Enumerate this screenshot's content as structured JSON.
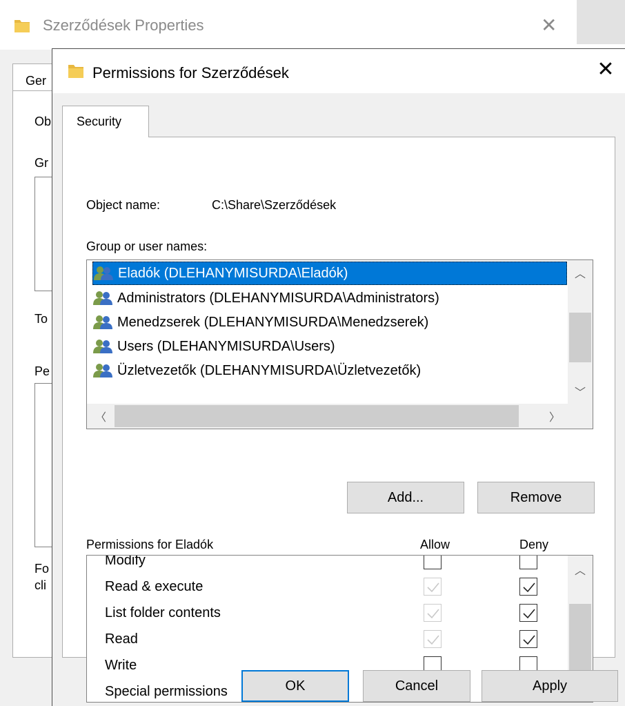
{
  "background_window": {
    "title": "Szerződések Properties",
    "tab_label": "Ger",
    "fragments": [
      "Ob",
      "Gr",
      "To",
      "Pe",
      "Fo",
      "cli"
    ]
  },
  "dialog": {
    "title": "Permissions for Szerződések",
    "tab": "Security",
    "object_name_label": "Object name:",
    "object_name_value": "C:\\Share\\Szerződések",
    "group_label": "Group or user names:",
    "users": [
      {
        "label": "Eladók (DLEHANYMISURDA\\Eladók)",
        "selected": true
      },
      {
        "label": "Administrators (DLEHANYMISURDA\\Administrators)",
        "selected": false
      },
      {
        "label": "Menedzserek (DLEHANYMISURDA\\Menedzserek)",
        "selected": false
      },
      {
        "label": "Users (DLEHANYMISURDA\\Users)",
        "selected": false
      },
      {
        "label": "Üzletvezetők (DLEHANYMISURDA\\Üzletvezetők)",
        "selected": false
      }
    ],
    "add_button": "Add...",
    "remove_button": "Remove",
    "permissions_title": "Permissions for Eladók",
    "allow_header": "Allow",
    "deny_header": "Deny",
    "permissions": [
      {
        "name": "Modify",
        "allow": false,
        "allow_disabled": false,
        "deny": false,
        "deny_disabled": false
      },
      {
        "name": "Read & execute",
        "allow": true,
        "allow_disabled": true,
        "deny": true,
        "deny_disabled": false
      },
      {
        "name": "List folder contents",
        "allow": true,
        "allow_disabled": true,
        "deny": true,
        "deny_disabled": false
      },
      {
        "name": "Read",
        "allow": true,
        "allow_disabled": true,
        "deny": true,
        "deny_disabled": false
      },
      {
        "name": "Write",
        "allow": false,
        "allow_disabled": false,
        "deny": false,
        "deny_disabled": false
      },
      {
        "name": "Special permissions",
        "allow": false,
        "allow_disabled": true,
        "deny": false,
        "deny_disabled": true
      }
    ],
    "ok_button": "OK",
    "cancel_button": "Cancel",
    "apply_button": "Apply"
  },
  "icons": {
    "folder": "folder-icon",
    "user_group": "user-group-icon",
    "close": "close-icon"
  },
  "colors": {
    "selection": "#0078d7",
    "folder": "#f0c040"
  }
}
